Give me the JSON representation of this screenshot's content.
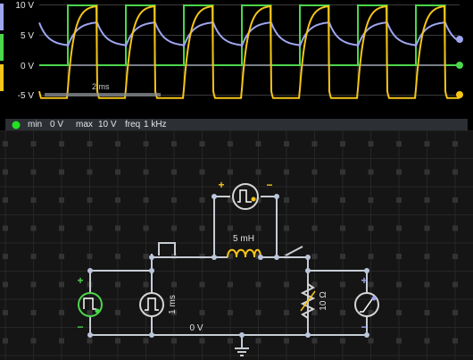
{
  "scope": {
    "y_axis_labels": [
      "10 V",
      "5 V",
      "0 V",
      "-5 V"
    ],
    "time_scale_label": "2 ms",
    "trace_colors": {
      "inductor_current": "#9ea6f0",
      "square_source": "#4cd64c",
      "inductor_voltage": "#f5c518"
    },
    "series": [
      {
        "name": "",
        "color": "#9ea6f0"
      },
      {
        "name": "",
        "color": "#4cd64c"
      },
      {
        "name": "",
        "color": "#f5c518"
      }
    ]
  },
  "info_bar": {
    "min_label": "min",
    "min_value": "0 V",
    "max_label": "max",
    "max_value": "10 V",
    "freq_label": "freq",
    "freq_value": "1 kHz",
    "indicator_color": "#22e022"
  },
  "circuit": {
    "inductor_label": "5 mH",
    "resistor_label": "10 Ω",
    "pulse_label": "1 ms",
    "ground_label": "0 V",
    "source_plus": "+",
    "source_minus": "−",
    "colors": {
      "wire": "#c7ccd3",
      "node": "#b9c6da",
      "accent": "#f5c518",
      "source": "#4cd64c"
    }
  }
}
